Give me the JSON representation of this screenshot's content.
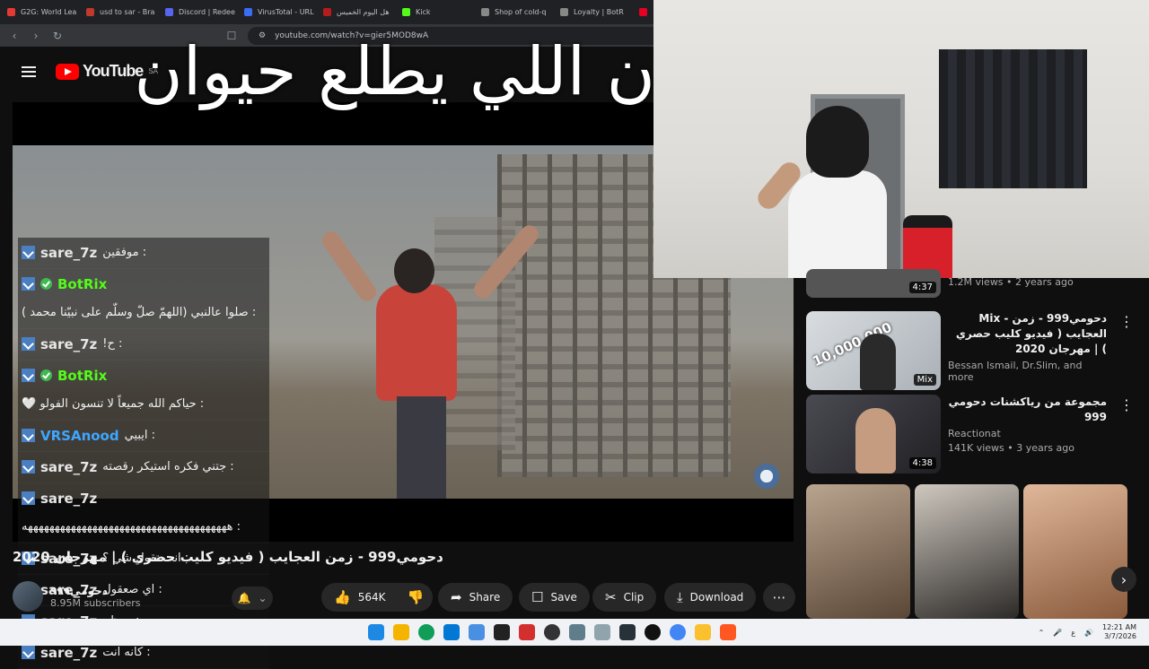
{
  "browser": {
    "tabs": [
      {
        "label": "G2G: World Lea",
        "color": "#e53935"
      },
      {
        "label": "usd to sar - Bra",
        "color": "#c0392b"
      },
      {
        "label": "Discord | Redee",
        "color": "#5865f2"
      },
      {
        "label": "VirusTotal - URL",
        "color": "#3a6cf4"
      },
      {
        "label": "هل اليوم الخميس",
        "color": "#b71c1c"
      },
      {
        "label": "Kick",
        "color": "#53fc18"
      },
      {
        "label": "Shop of cold-q",
        "color": "#888888"
      },
      {
        "label": "Loyalty | BotR",
        "color": "#888888"
      },
      {
        "label": "",
        "color": "#e60023"
      }
    ],
    "url": "youtube.com/watch?v=gier5MOD8wA"
  },
  "youtube": {
    "logo_text": "YouTube",
    "region": "SA"
  },
  "overlay_text": "ن اللي يطلع حيوان",
  "chat": {
    "messages": [
      {
        "user": "sare_7z",
        "text": ": موفقين",
        "user_color": "#e6e6e6",
        "verified": false
      },
      {
        "user": "BotRix",
        "text": ": صلوا عالنبي (اللهمّ صلّ وسلّم على نبيّنا محمد )",
        "user_color": "#53fc18",
        "verified": true
      },
      {
        "user": "sare_7z",
        "text": ": ح!",
        "user_color": "#e6e6e6",
        "verified": false
      },
      {
        "user": "BotRix",
        "text": ": حياكم الله جميعاً لا تنسون الفولو 🤍",
        "user_color": "#53fc18",
        "verified": true
      },
      {
        "user": "VRSAnood",
        "text": ": ايبيي",
        "user_color": "#3ea6ff",
        "verified": false
      },
      {
        "user": "sare_7z",
        "text": ": جتني فكره استيكر رقصته",
        "user_color": "#e6e6e6",
        "verified": false
      },
      {
        "user": "sare_7z",
        "text": ": ههههههههههههههههههههههههههههههههههههههه",
        "user_color": "#e6e6e6",
        "verified": false
      },
      {
        "user": "sare_7z",
        "text": ": انت تقول شي ؟",
        "user_color": "#e6e6e6",
        "verified": false
      },
      {
        "user": "sare_7z",
        "text": ": اي صعقول",
        "user_color": "#e6e6e6",
        "verified": false
      },
      {
        "user": "sare_7z",
        "text": ": معظم",
        "user_color": "#e6e6e6",
        "verified": false
      },
      {
        "user": "sare_7z",
        "text": ": كانه انت",
        "user_color": "#e6e6e6",
        "verified": false
      }
    ]
  },
  "video": {
    "title": "دحومي999 - زمن العجايب ( فيديو كليب حصري ) | مهرجان 2020",
    "channel": "دحومي٩٩٩",
    "subscribers": "8.95M subscribers",
    "likes": "564K",
    "share_label": "Share",
    "save_label": "Save",
    "clip_label": "Clip",
    "download_label": "Download"
  },
  "recommendations": [
    {
      "title": "",
      "meta1": "",
      "meta2": "1.2M views • 2 years ago",
      "duration": "4:37",
      "thumb": "#5a5a5a"
    },
    {
      "title": "Mix - دحومي999 - زمن العجايب ( فيديو كليب حصري ) | مهرجان 2020",
      "meta1": "Bessan Ismail, Dr.Slim, and more",
      "meta2": "",
      "duration": "Mix",
      "thumb_text": "10,000,000",
      "thumb": "#c8cdd2"
    },
    {
      "title": "مجموعة من رياكشنات دحومي 999",
      "meta1": "Reactionat",
      "meta2": "141K views • 3 years ago",
      "duration": "4:38",
      "thumb": "#3a3a40"
    }
  ],
  "shorts_next_icon": "chevron-right-icon",
  "taskbar": {
    "time": "12:21 AM",
    "date": "3/7/2026",
    "lang": "ع"
  }
}
